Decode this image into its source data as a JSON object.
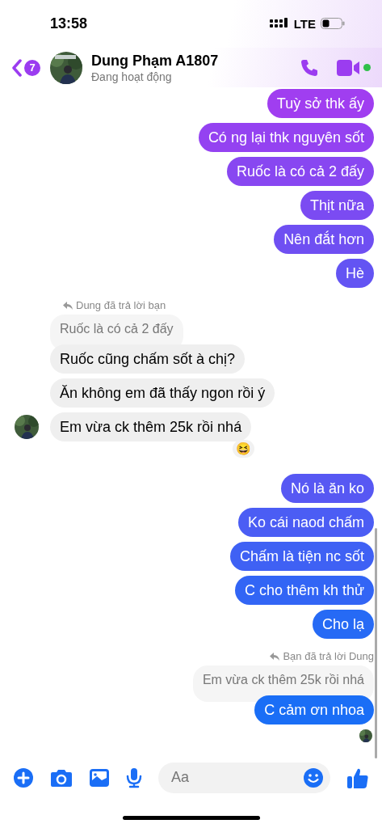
{
  "status_bar": {
    "time": "13:58",
    "network": "LTE"
  },
  "header": {
    "unread_count": "7",
    "name": "Dung Phạm A1807",
    "status": "Đang hoạt động",
    "online": true
  },
  "groups": [
    {
      "kind": "out",
      "messages": [
        "Tuỳ sở thk ấy",
        "Có ng lại thk nguyên sốt",
        "Ruốc là có cả 2 đấy",
        "Thịt nữa",
        "Nên đắt hơn",
        "Hè"
      ]
    },
    {
      "kind": "in",
      "reply_note": "Dung đã trả lời bạn",
      "quoted": "Ruốc là có cả 2 đấy",
      "messages": [
        "Ruốc cũng chấm sốt à chị?",
        "Ăn không em đã thấy ngon rồi ý",
        "Em vừa ck thêm 25k rồi nhá"
      ],
      "reaction": "😆"
    },
    {
      "kind": "out",
      "messages": [
        "Nó là ăn ko",
        "Ko cái naod chấm",
        "Chấm là tiện nc sốt",
        "C cho thêm kh thử",
        "Cho lạ"
      ]
    },
    {
      "kind": "out",
      "reply_note": "Bạn đã trả lời Dung",
      "quoted": "Em vừa ck thêm 25k rồi nhá",
      "messages": [
        "C cảm ơn nhoa"
      ],
      "seen": true
    }
  ],
  "composer": {
    "placeholder": "Aa"
  }
}
